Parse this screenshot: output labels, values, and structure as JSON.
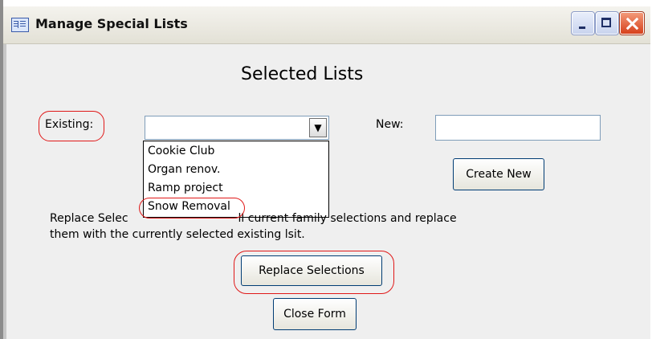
{
  "window": {
    "title": "Manage Special Lists"
  },
  "form": {
    "heading": "Selected Lists",
    "existing_label": "Existing:",
    "existing_value": "",
    "existing_options": [
      "Cookie Club",
      "Organ renov.",
      "Ramp project",
      "Snow Removal"
    ],
    "new_label": "New:",
    "new_value": "",
    "create_button": "Create New",
    "replace_text_prefix": "Replace Selec",
    "replace_text_tail": "ll current family selections and replace",
    "replace_text_line2": "them with the currently selected existing lsit.",
    "replace_button": "Replace Selections",
    "close_button": "Close Form"
  },
  "colors": {
    "annotation": "#e01818",
    "form_background": "#efefef",
    "button_border": "#003c74"
  }
}
